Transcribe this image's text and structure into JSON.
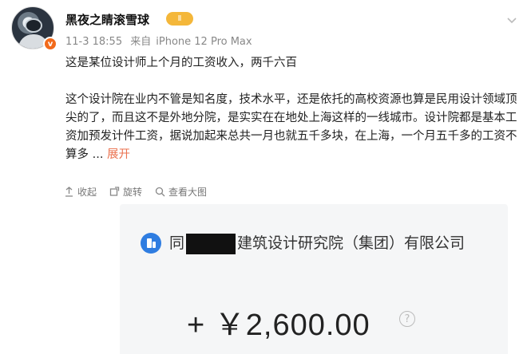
{
  "user": {
    "name": "黑夜之睛滚雪球",
    "level_badge": "Ⅱ",
    "verified_badge": "v",
    "date": "11-3 18:55",
    "source_prefix": "来自",
    "device": "iPhone 12 Pro Max"
  },
  "post": {
    "headline": "这是某位设计师上个月的工资收入，两千六百",
    "body": "这个设计院在业内不管是知名度，技术水平，还是依托的高校资源也算是民用设计领域顶尖的了，而且这不是外地分院，是实实在在地处上海这样的一线城市。设计院都是基本工资加预发计件工资，据说加起来总共一月也就五千多块，在上海，一个月五千多的工资不算多 ...",
    "expand_label": "展开"
  },
  "actions": {
    "collapse": "收起",
    "repost": "旋转",
    "view_image": "查看大图"
  },
  "screenshot": {
    "company_prefix": "同",
    "company_suffix": "建筑设计研究院（集团）有限公司",
    "amount": "+ ￥2,600.00"
  },
  "icons": {
    "collapse": "arrow-collapse-icon",
    "repost": "rotate-icon",
    "view_image": "zoom-icon",
    "help": "question-icon",
    "company": "building-icon"
  }
}
